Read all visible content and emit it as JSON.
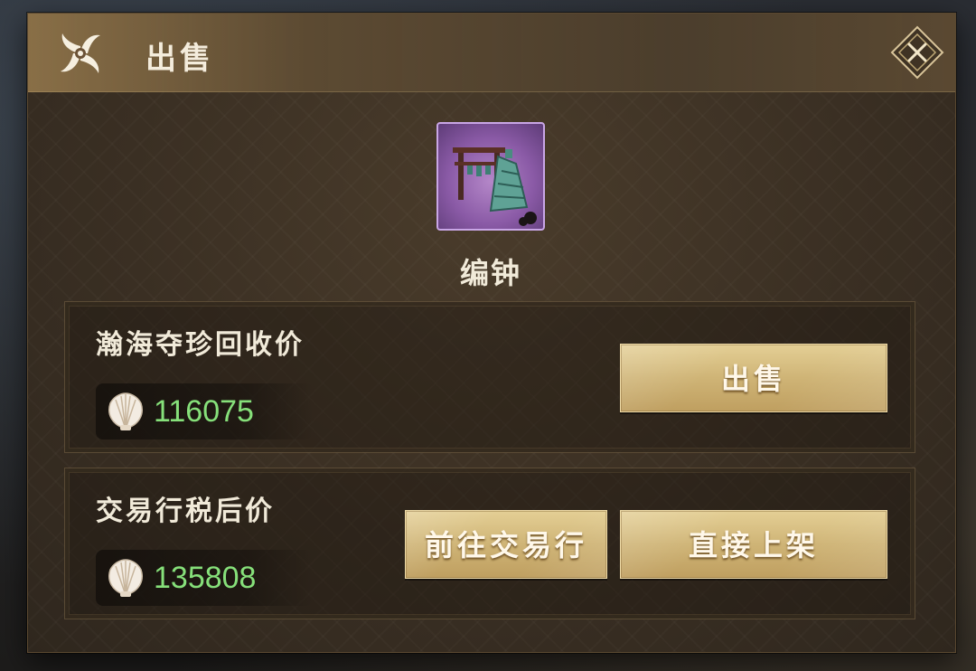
{
  "dialog": {
    "title": "出售",
    "close_icon": "close-x-icon"
  },
  "item": {
    "name": "编钟",
    "rarity_color": "#8a5aa6",
    "icon": "bronze-bells-icon"
  },
  "recycle": {
    "label": "瀚海夺珍回收价",
    "currency_icon": "shell-icon",
    "price": "116075",
    "sell_button": "出售"
  },
  "market": {
    "label": "交易行税后价",
    "currency_icon": "shell-icon",
    "price": "135808",
    "goto_button": "前往交易行",
    "list_button": "直接上架"
  },
  "colors": {
    "price_green": "#86e07a",
    "button_gold": "#cfb476",
    "text_light": "#f1ead9"
  }
}
